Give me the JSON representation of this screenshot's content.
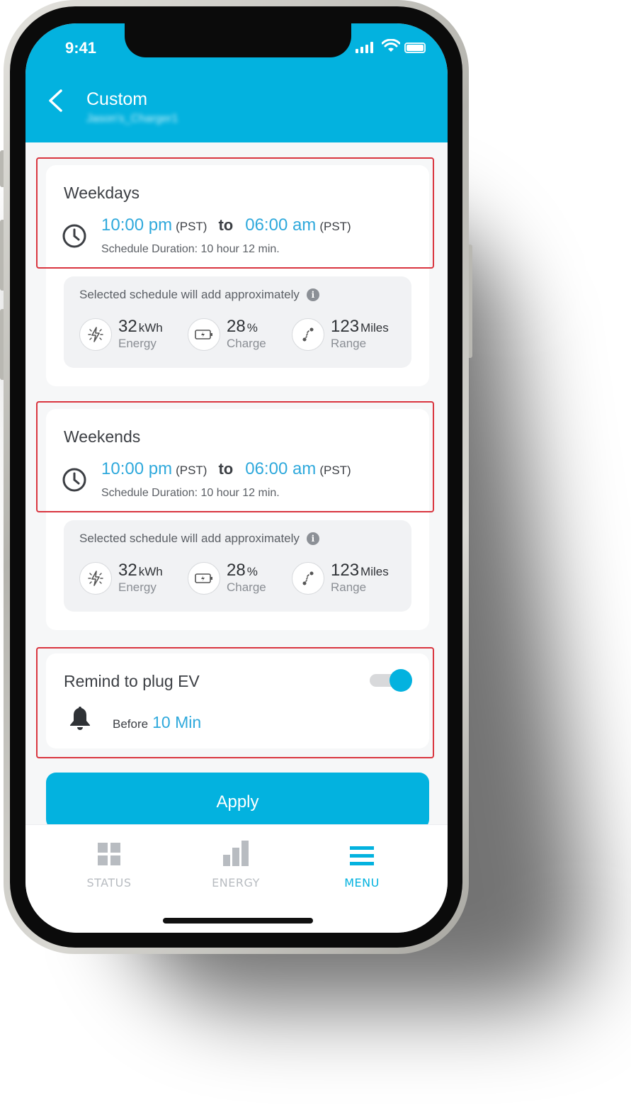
{
  "status_bar": {
    "time": "9:41"
  },
  "header": {
    "title": "Custom",
    "subtitle": "Jason's_Charger1"
  },
  "schedules": [
    {
      "title": "Weekdays",
      "start": "10:00 pm",
      "start_tz": "(PST)",
      "to": "to",
      "end": "06:00 am",
      "end_tz": "(PST)",
      "duration": "Schedule Duration: 10 hour 12 min.",
      "approx_label": "Selected schedule will add approximately",
      "energy": {
        "value": "32",
        "unit": "kWh",
        "label": "Energy"
      },
      "charge": {
        "value": "28",
        "unit": "%",
        "label": "Charge"
      },
      "range": {
        "value": "123",
        "unit": "Miles",
        "label": "Range"
      }
    },
    {
      "title": "Weekends",
      "start": "10:00 pm",
      "start_tz": "(PST)",
      "to": "to",
      "end": "06:00 am",
      "end_tz": "(PST)",
      "duration": "Schedule Duration: 10 hour 12 min.",
      "approx_label": "Selected schedule will add approximately",
      "energy": {
        "value": "32",
        "unit": "kWh",
        "label": "Energy"
      },
      "charge": {
        "value": "28",
        "unit": "%",
        "label": "Charge"
      },
      "range": {
        "value": "123",
        "unit": "Miles",
        "label": "Range"
      }
    }
  ],
  "reminder": {
    "title": "Remind to plug EV",
    "enabled": true,
    "before_label": "Before",
    "before_value": "10 Min"
  },
  "apply_label": "Apply",
  "tabs": [
    {
      "label": "STATUS",
      "icon": "grid-icon",
      "active": false
    },
    {
      "label": "ENERGY",
      "icon": "bar-chart-icon",
      "active": false
    },
    {
      "label": "MENU",
      "icon": "hamburger-icon",
      "active": true
    }
  ],
  "colors": {
    "accent": "#03b2df",
    "time_text": "#2fa9dc",
    "highlight": "#d9353f",
    "inactive_tab": "#b8bcc1"
  }
}
